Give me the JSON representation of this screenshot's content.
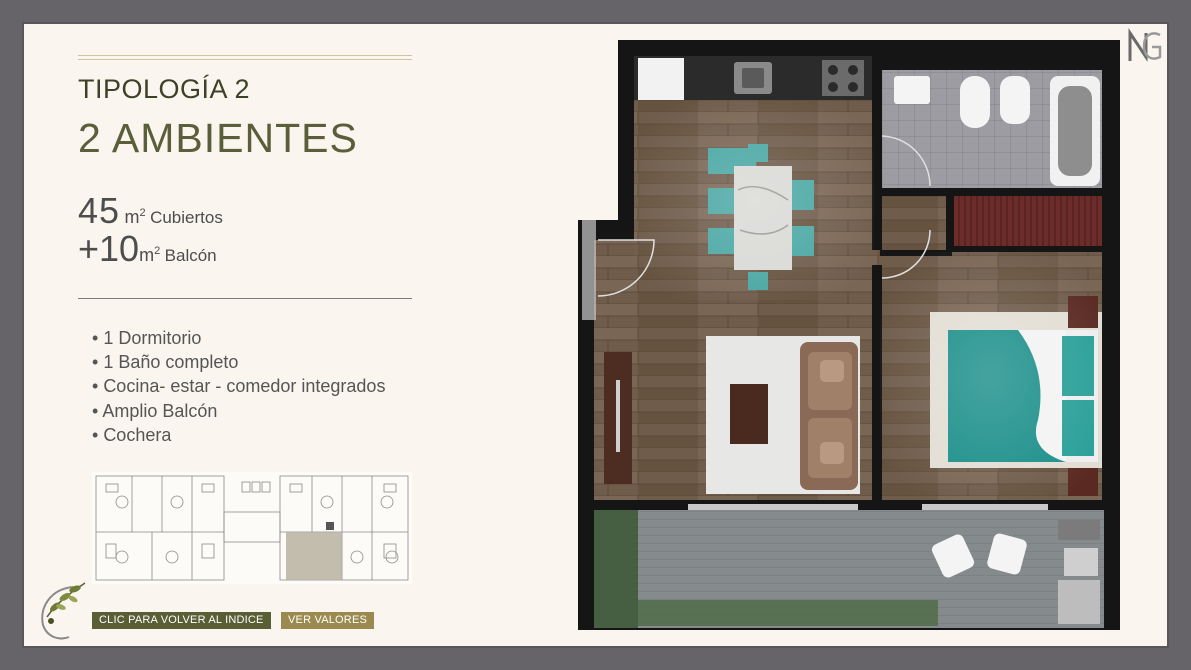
{
  "header": {
    "tipologia": "TIPOLOGÍA 2",
    "ambientes": "2 AMBIENTES"
  },
  "area": {
    "covered_value": "45",
    "covered_unit": "m",
    "covered_sup": "2",
    "covered_label": "Cubiertos",
    "balcony_value": "+10",
    "balcony_unit": "m",
    "balcony_sup": "2",
    "balcony_label": "Balcón"
  },
  "features": [
    "1 Dormitorio",
    "1 Baño completo",
    "Cocina- estar - comedor integrados",
    "Amplio Balcón",
    "Cochera"
  ],
  "buttons": {
    "back_label": "CLIC PARA VOLVER AL INDICE",
    "values_label": "VER VALORES"
  },
  "colors": {
    "frame": "#676469",
    "background": "#faf6ef",
    "title_dark": "#3d4226",
    "title_olive": "#5a5f3a",
    "back_button": "#5a5e34",
    "values_button": "#9a8a4f",
    "bed_teal": "#1c8f8a",
    "floor_wood": "#6e5b4a"
  },
  "icons": {
    "brand": "brand-monogram-icon",
    "logo": "olive-branch-logo-icon"
  }
}
